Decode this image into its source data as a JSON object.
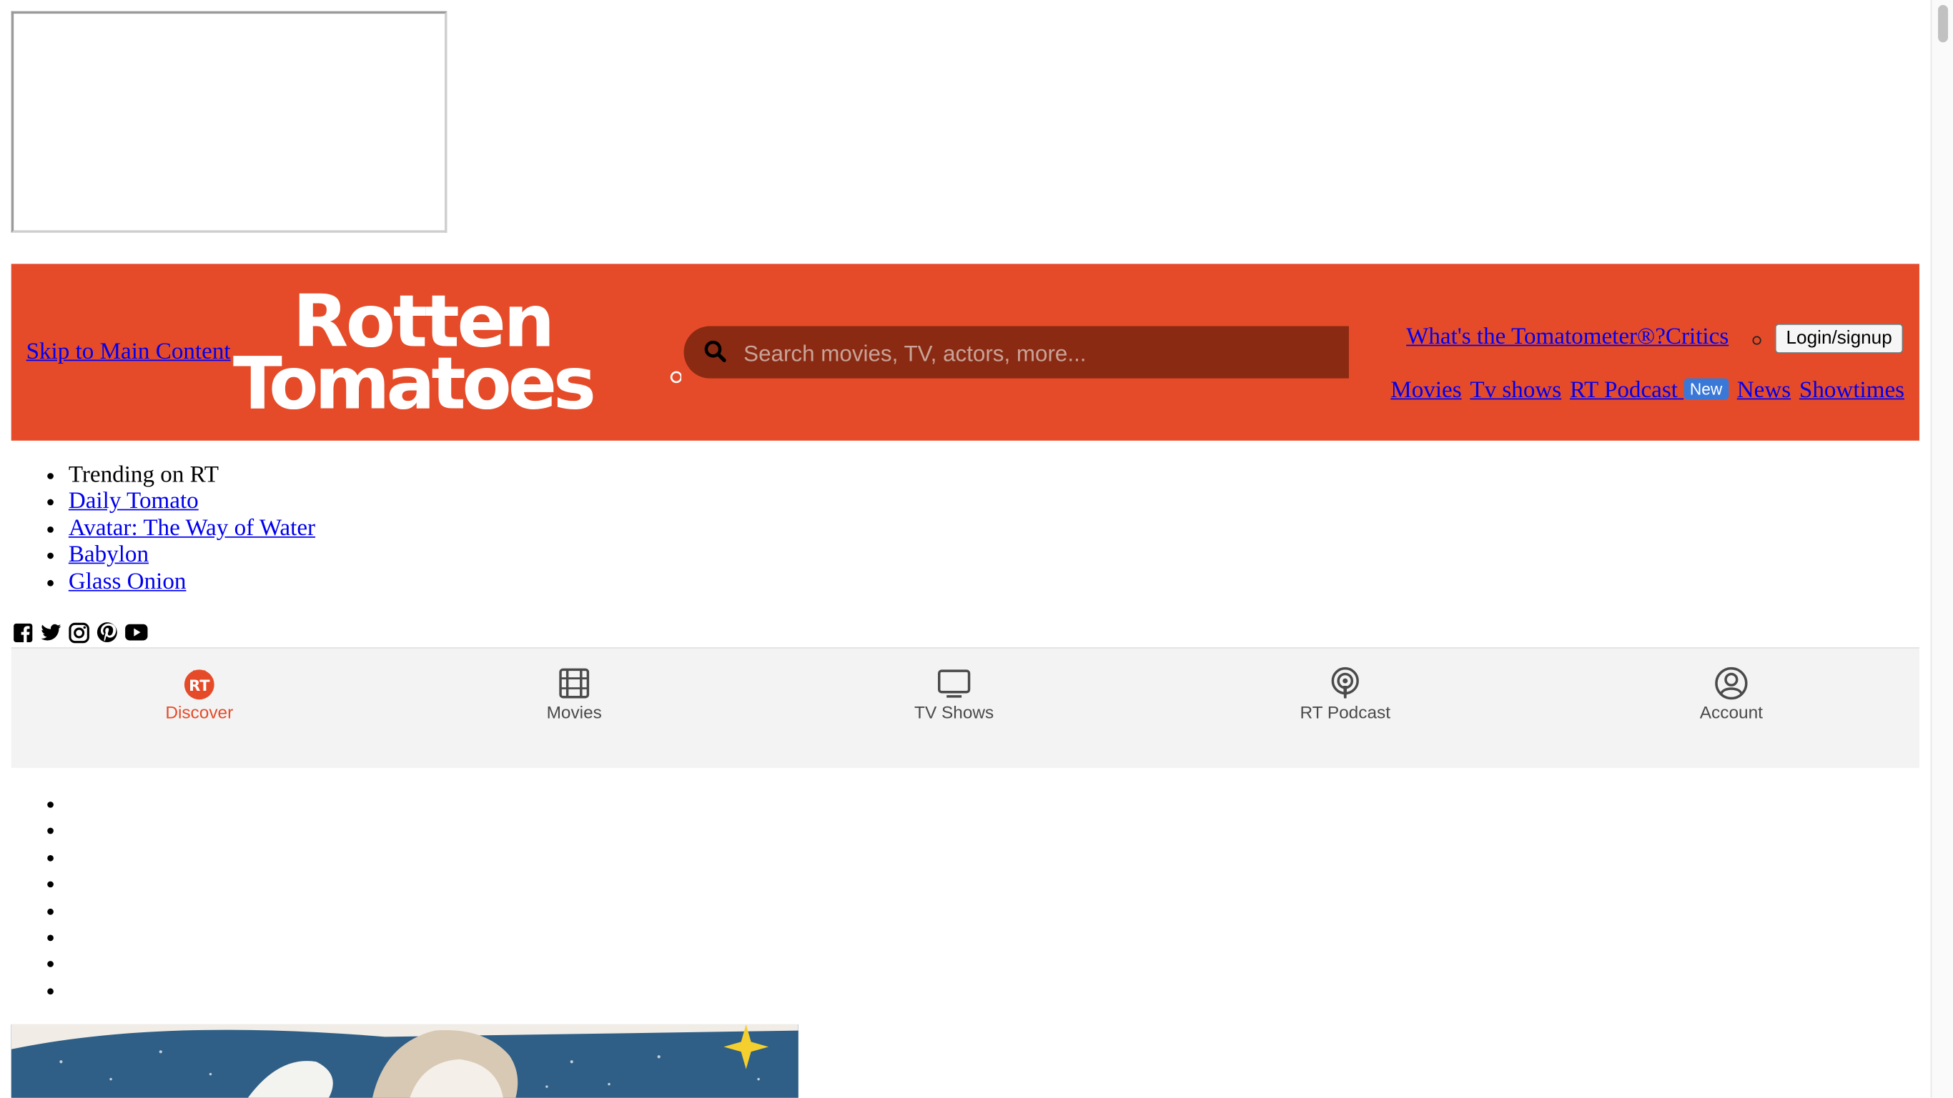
{
  "header": {
    "skip_link": "Skip to Main Content",
    "logo_line1": "Rotten",
    "logo_line2": "Tomatoes",
    "search_placeholder": "Search movies, TV, actors, more...",
    "tomatometer_link": "What's the Tomatometer®?",
    "critics_link": "Critics",
    "login_label": "Login/signup",
    "nav": {
      "movies": "Movies",
      "tv_shows": "Tv shows",
      "rt_podcast": "RT Podcast",
      "new_badge": "New",
      "news": "News",
      "showtimes": "Showtimes"
    },
    "accent_color": "#e54b29"
  },
  "trending": {
    "label": "Trending on RT",
    "items": [
      "Daily Tomato",
      "Avatar: The Way of Water",
      "Babylon",
      "Glass Onion"
    ]
  },
  "social_icons": [
    "facebook-icon",
    "twitter-icon",
    "instagram-icon",
    "pinterest-icon",
    "youtube-icon"
  ],
  "bottom_nav": {
    "items": [
      {
        "label": "Discover",
        "icon": "rt-logo-icon",
        "active": true
      },
      {
        "label": "Movies",
        "icon": "film-icon"
      },
      {
        "label": "TV Shows",
        "icon": "tv-icon"
      },
      {
        "label": "RT Podcast",
        "icon": "podcast-icon"
      },
      {
        "label": "Account",
        "icon": "account-icon"
      }
    ]
  }
}
